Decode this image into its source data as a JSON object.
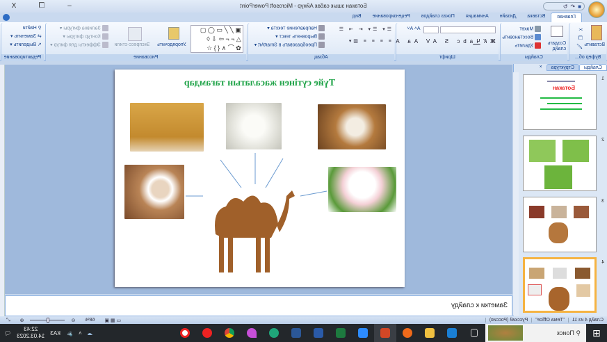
{
  "window": {
    "title": "Ботакан  зшык сабак Айнур - Microsoft PowerPoint",
    "minimize": "–",
    "restore": "❐",
    "close": "X"
  },
  "tabs": [
    "Главная",
    "Вставка",
    "Дизайн",
    "Анимация",
    "Показ слайдов",
    "Рецензирование",
    "Вид"
  ],
  "ribbon": {
    "clipboard": {
      "label": "Буфер об...",
      "paste": "Вставить"
    },
    "slides": {
      "label": "Слайды",
      "create": "Создать слайд",
      "layout": "Макет",
      "reset": "Восстановить",
      "delete": "Удалить"
    },
    "font": {
      "label": "Шрифт"
    },
    "paragraph": {
      "label": "Абзац",
      "direction": "Направление текста",
      "align": "Выровнять текст",
      "smartart": "Преобразовать в SmartArt"
    },
    "drawing": {
      "label": "Рисование",
      "arrange": "Упорядочить",
      "styles": "Экспресс-стили",
      "fill": "Заливка фигуры",
      "outline": "Контур фигуры",
      "effects": "Эффекты для фигур"
    },
    "editing": {
      "label": "Редактирование",
      "find": "Найти",
      "replace": "Заменить",
      "select": "Выделить"
    }
  },
  "panel": {
    "tabs": [
      "Слайды",
      "Структура"
    ],
    "thumbs": [
      "1",
      "2",
      "3",
      "4"
    ],
    "thumb1": {
      "heading": "Ботакан"
    }
  },
  "slide": {
    "title": "Түйе сүтінен  жасалатын тағамдар"
  },
  "notes": {
    "placeholder": "Заметки к слайду"
  },
  "status": {
    "slide": "Слайд 4 из 11",
    "theme": "\"Тема Office\"",
    "language": "Русский (Россия)",
    "zoom": "68%",
    "zoom_value": 68
  },
  "taskbar": {
    "search": "Поиск",
    "time": "22:43",
    "date": "14.03.2023",
    "lang": "КАЗ"
  }
}
